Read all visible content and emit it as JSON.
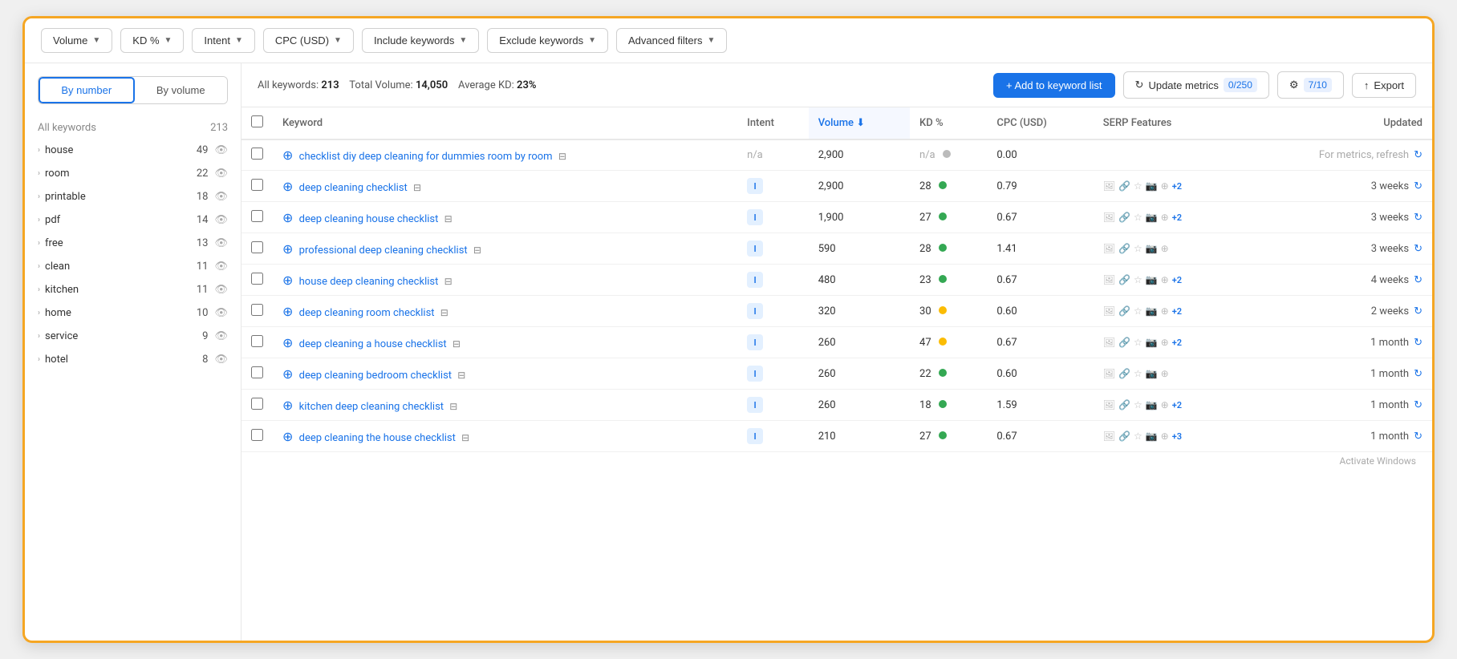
{
  "filters": {
    "volume_label": "Volume",
    "kd_label": "KD %",
    "intent_label": "Intent",
    "cpc_label": "CPC (USD)",
    "include_label": "Include keywords",
    "exclude_label": "Exclude keywords",
    "advanced_label": "Advanced filters"
  },
  "view_toggle": {
    "by_number": "By number",
    "by_volume": "By volume"
  },
  "sidebar": {
    "all_keywords_label": "All keywords",
    "all_keywords_count": "213",
    "items": [
      {
        "keyword": "house",
        "count": 49
      },
      {
        "keyword": "room",
        "count": 22
      },
      {
        "keyword": "printable",
        "count": 18
      },
      {
        "keyword": "pdf",
        "count": 14
      },
      {
        "keyword": "free",
        "count": 13
      },
      {
        "keyword": "clean",
        "count": 11
      },
      {
        "keyword": "kitchen",
        "count": 11
      },
      {
        "keyword": "home",
        "count": 10
      },
      {
        "keyword": "service",
        "count": 9
      },
      {
        "keyword": "hotel",
        "count": 8
      }
    ]
  },
  "stats": {
    "all_keywords_label": "All keywords:",
    "all_keywords_value": "213",
    "total_volume_label": "Total Volume:",
    "total_volume_value": "14,050",
    "avg_kd_label": "Average KD:",
    "avg_kd_value": "23%"
  },
  "actions": {
    "add_btn": "+ Add to keyword list",
    "update_btn": "Update metrics",
    "counter": "0/250",
    "settings_counter": "7/10",
    "export_btn": "Export"
  },
  "table": {
    "col_keyword": "Keyword",
    "col_intent": "Intent",
    "col_volume": "Volume",
    "col_kd": "KD %",
    "col_cpc": "CPC (USD)",
    "col_serp": "SERP Features",
    "col_updated": "Updated",
    "rows": [
      {
        "keyword": "checklist diy deep cleaning for dummies room by room",
        "intent": "n/a",
        "volume": "2,900",
        "kd": "n/a",
        "kd_dot": "gray",
        "cpc": "0.00",
        "serp": [],
        "serp_plus": "",
        "updated": "For metrics, refresh",
        "refresh": true
      },
      {
        "keyword": "deep cleaning checklist",
        "intent": "I",
        "volume": "2,900",
        "kd": "28",
        "kd_dot": "green",
        "cpc": "0.79",
        "serp": [
          "img",
          "link",
          "star",
          "img2",
          "circle"
        ],
        "serp_plus": "+2",
        "updated": "3 weeks",
        "refresh": true
      },
      {
        "keyword": "deep cleaning house checklist",
        "intent": "I",
        "volume": "1,900",
        "kd": "27",
        "kd_dot": "green",
        "cpc": "0.67",
        "serp": [
          "img",
          "link",
          "star",
          "img2",
          "circle"
        ],
        "serp_plus": "+2",
        "updated": "3 weeks",
        "refresh": true
      },
      {
        "keyword": "professional deep cleaning checklist",
        "intent": "I",
        "volume": "590",
        "kd": "28",
        "kd_dot": "green",
        "cpc": "1.41",
        "serp": [
          "img",
          "star",
          "img2",
          "circle",
          "list"
        ],
        "serp_plus": "",
        "updated": "3 weeks",
        "refresh": true
      },
      {
        "keyword": "house deep cleaning checklist",
        "intent": "I",
        "volume": "480",
        "kd": "23",
        "kd_dot": "green",
        "cpc": "0.67",
        "serp": [
          "img",
          "link",
          "star",
          "img2",
          "circle"
        ],
        "serp_plus": "+2",
        "updated": "4 weeks",
        "refresh": true
      },
      {
        "keyword": "deep cleaning room checklist",
        "intent": "I",
        "volume": "320",
        "kd": "30",
        "kd_dot": "orange",
        "cpc": "0.60",
        "serp": [
          "img",
          "link",
          "star",
          "img2",
          "circle"
        ],
        "serp_plus": "+2",
        "updated": "2 weeks",
        "refresh": true
      },
      {
        "keyword": "deep cleaning a house checklist",
        "intent": "I",
        "volume": "260",
        "kd": "47",
        "kd_dot": "orange",
        "cpc": "0.67",
        "serp": [
          "img",
          "link",
          "star",
          "img2",
          "circle"
        ],
        "serp_plus": "+2",
        "updated": "1 month",
        "refresh": true
      },
      {
        "keyword": "deep cleaning bedroom checklist",
        "intent": "I",
        "volume": "260",
        "kd": "22",
        "kd_dot": "green",
        "cpc": "0.60",
        "serp": [
          "img",
          "star",
          "img2",
          "circle",
          "list"
        ],
        "serp_plus": "",
        "updated": "1 month",
        "refresh": true
      },
      {
        "keyword": "kitchen deep cleaning checklist",
        "intent": "I",
        "volume": "260",
        "kd": "18",
        "kd_dot": "green",
        "cpc": "1.59",
        "serp": [
          "img",
          "link",
          "star",
          "img2",
          "circle"
        ],
        "serp_plus": "+2",
        "updated": "1 month",
        "refresh": true
      },
      {
        "keyword": "deep cleaning the house checklist",
        "intent": "I",
        "volume": "210",
        "kd": "27",
        "kd_dot": "green",
        "cpc": "0.67",
        "serp": [
          "img",
          "link",
          "star",
          "img2",
          "circle"
        ],
        "serp_plus": "+3",
        "updated": "1 month",
        "refresh": true
      }
    ]
  },
  "watermark": "Activate Windows"
}
